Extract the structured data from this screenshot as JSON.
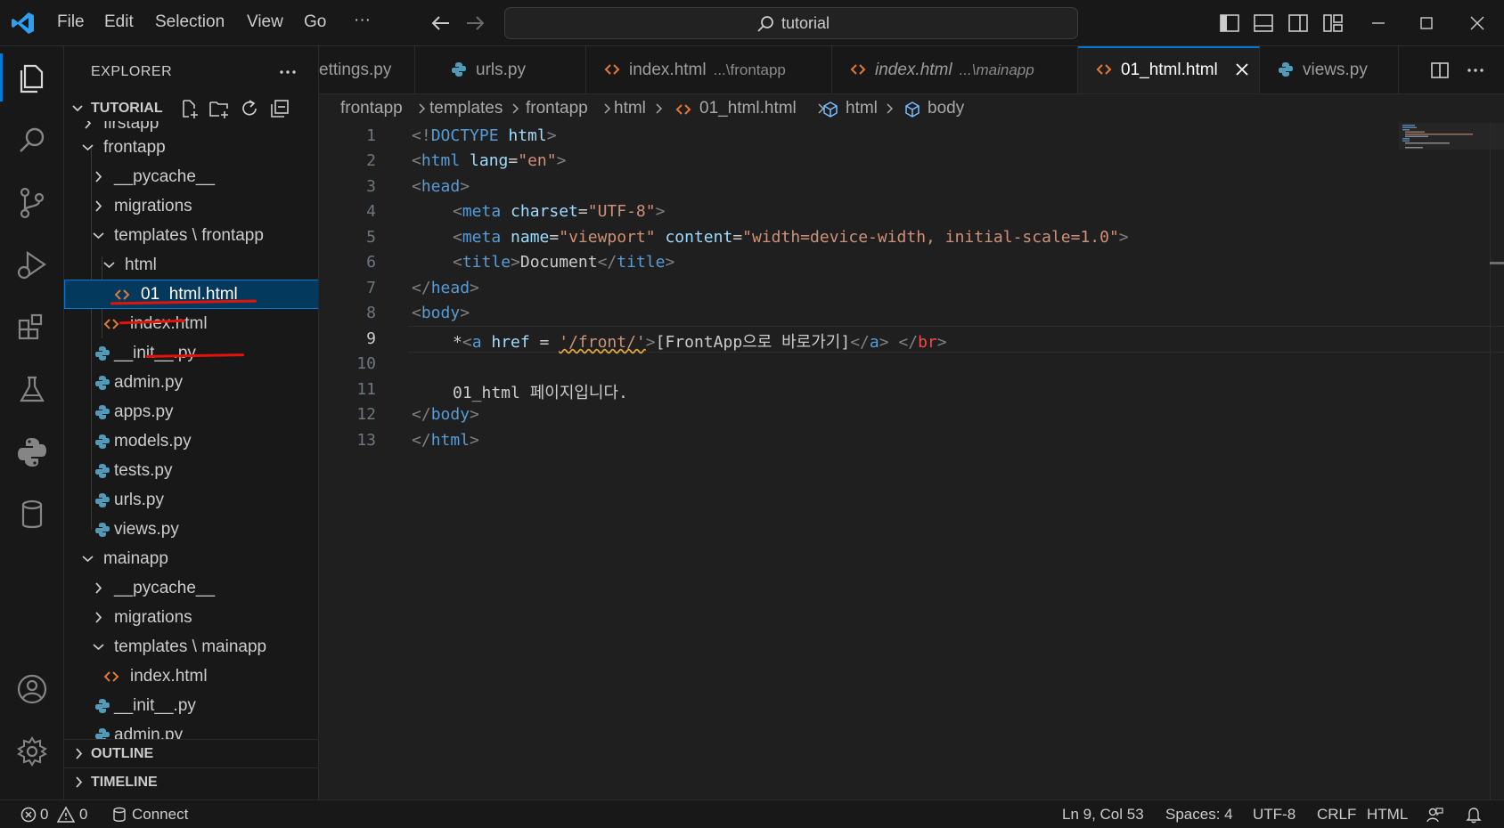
{
  "menu": {
    "file": "File",
    "edit": "Edit",
    "selection": "Selection",
    "view": "View",
    "go": "Go",
    "more": "···"
  },
  "search": {
    "text": "tutorial"
  },
  "sidebar": {
    "title": "EXPLORER",
    "more": "···",
    "section": "TUTORIAL",
    "tree": [
      {
        "label": "firstapp",
        "kind": "folder-partial"
      },
      {
        "label": "frontapp",
        "kind": "folder-open"
      },
      {
        "label": "__pycache__",
        "kind": "folder-closed"
      },
      {
        "label": "migrations",
        "kind": "folder-closed"
      },
      {
        "label": "templates",
        "label2": "frontapp",
        "kind": "folder-open"
      },
      {
        "label": "html",
        "kind": "folder-open"
      },
      {
        "label": "01_html.html",
        "kind": "html-file"
      },
      {
        "label": "index.html",
        "kind": "html-file"
      },
      {
        "label": "__init__.py",
        "kind": "py-file"
      },
      {
        "label": "admin.py",
        "kind": "py-file"
      },
      {
        "label": "apps.py",
        "kind": "py-file"
      },
      {
        "label": "models.py",
        "kind": "py-file"
      },
      {
        "label": "tests.py",
        "kind": "py-file"
      },
      {
        "label": "urls.py",
        "kind": "py-file"
      },
      {
        "label": "views.py",
        "kind": "py-file"
      },
      {
        "label": "mainapp",
        "kind": "folder-open"
      },
      {
        "label": "__pycache__",
        "kind": "folder-closed"
      },
      {
        "label": "migrations",
        "kind": "folder-closed"
      },
      {
        "label": "templates",
        "label2": "mainapp",
        "kind": "folder-open"
      },
      {
        "label": "index.html",
        "kind": "html-file"
      },
      {
        "label": "__init__.py",
        "kind": "py-file"
      },
      {
        "label": "admin.py",
        "kind": "py-file"
      }
    ],
    "outline": "OUTLINE",
    "timeline": "TIMELINE"
  },
  "tabs": [
    {
      "label": "ettings.py",
      "desc": "",
      "kind": "py"
    },
    {
      "label": "urls.py",
      "desc": "",
      "kind": "py"
    },
    {
      "label": "index.html",
      "desc": "...\\frontapp",
      "kind": "html"
    },
    {
      "label": "index.html",
      "desc": "...\\mainapp",
      "kind": "html"
    },
    {
      "label": "01_html.html",
      "desc": "",
      "kind": "html"
    },
    {
      "label": "views.py",
      "desc": "",
      "kind": "py"
    }
  ],
  "breadcrumb": {
    "c1": "frontapp",
    "c2": "templates",
    "c3": "frontapp",
    "c4": "html",
    "c5": "01_html.html",
    "c6": "html",
    "c7": "body"
  },
  "editor": {
    "line_numbers": [
      "1",
      "2",
      "3",
      "4",
      "5",
      "6",
      "7",
      "8",
      "9",
      "10",
      "11",
      "12",
      "13"
    ],
    "l1": {
      "a": "<!",
      "b": "DOCTYPE",
      "c": " html",
      "d": ">"
    },
    "l2": {
      "a": "<",
      "b": "html",
      "c": " lang",
      "d": "=",
      "e": "\"en\"",
      "f": ">"
    },
    "l3": {
      "a": "<",
      "b": "head",
      "c": ">"
    },
    "l4": {
      "a": "<",
      "b": "meta",
      "c": " charset",
      "d": "=",
      "e": "\"UTF-8\"",
      "f": ">"
    },
    "l5": {
      "a": "<",
      "b": "meta",
      "c": " name",
      "d": "=",
      "e": "\"viewport\"",
      "f": " content",
      "g": "=",
      "h": "\"width=device-width, initial-scale=1.0\"",
      "i": ">"
    },
    "l6": {
      "a": "<",
      "b": "title",
      "c": ">",
      "d": "Document",
      "e": "</",
      "f": "title",
      "g": ">"
    },
    "l7": {
      "a": "</",
      "b": "head",
      "c": ">"
    },
    "l8": {
      "a": "<",
      "b": "body",
      "c": ">"
    },
    "l9": {
      "a": "*",
      "b": "<",
      "c": "a",
      "d": " href",
      "e": " = ",
      "f": "'/front/'",
      "g": ">",
      "h": "[FrontApp으로 바로가기]",
      "i": "</",
      "j": "a",
      "k": ">",
      "l": " </",
      "m": "br",
      "n": ">"
    },
    "l11": {
      "a": "01_html 페이지입니다."
    },
    "l12": {
      "a": "</",
      "b": "body",
      "c": ">"
    },
    "l13": {
      "a": "</",
      "b": "html",
      "c": ">"
    }
  },
  "status": {
    "errors": "0",
    "warnings": "0",
    "connect": "Connect",
    "position": "Ln 9, Col 53",
    "spaces": "Spaces: 4",
    "encoding": "UTF-8",
    "eol": "CRLF",
    "language": "HTML"
  },
  "colors": {
    "accent": "#0078d4",
    "annotation": "#e3130a",
    "html_icon": "#e37933",
    "py_icon": "#519aba"
  }
}
